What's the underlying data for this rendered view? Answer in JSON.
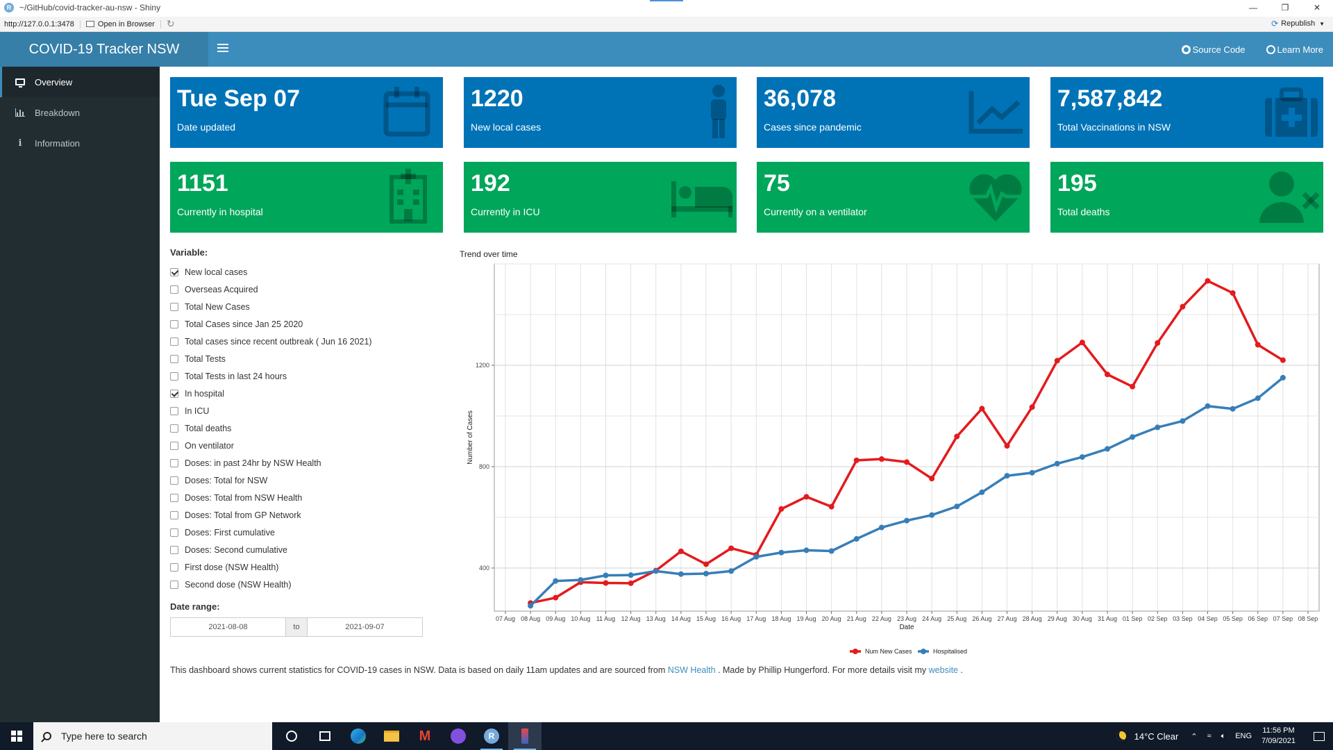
{
  "window": {
    "title": "~/GitHub/covid-tracker-au-nsw - Shiny",
    "url": "http://127.0.0.1:3478",
    "open_in_browser": "Open in Browser",
    "republish": "Republish"
  },
  "header": {
    "app_title": "COVID-19 Tracker NSW",
    "source_code": "Source Code",
    "learn_more": "Learn More"
  },
  "sidebar": {
    "items": [
      {
        "label": "Overview",
        "icon": "monitor-icon",
        "active": true
      },
      {
        "label": "Breakdown",
        "icon": "bar-chart-icon",
        "active": false
      },
      {
        "label": "Information",
        "icon": "info-icon",
        "active": false
      }
    ]
  },
  "value_boxes": [
    {
      "value": "Tue Sep 07",
      "subtitle": "Date updated",
      "color": "#0073b7",
      "icon": "calendar-icon"
    },
    {
      "value": "1220",
      "subtitle": "New local cases",
      "color": "#0073b7",
      "icon": "person-icon"
    },
    {
      "value": "36,078",
      "subtitle": "Cases since pandemic",
      "color": "#0073b7",
      "icon": "line-chart-icon"
    },
    {
      "value": "7,587,842",
      "subtitle": "Total Vaccinations in NSW",
      "color": "#0073b7",
      "icon": "medkit-icon"
    },
    {
      "value": "1151",
      "subtitle": "Currently in hospital",
      "color": "#00a65a",
      "icon": "hospital-icon"
    },
    {
      "value": "192",
      "subtitle": "Currently in ICU",
      "color": "#00a65a",
      "icon": "bed-icon"
    },
    {
      "value": "75",
      "subtitle": "Currently on a ventilator",
      "color": "#00a65a",
      "icon": "heartbeat-icon"
    },
    {
      "value": "195",
      "subtitle": "Total deaths",
      "color": "#00a65a",
      "icon": "user-times-icon"
    }
  ],
  "variable_panel": {
    "label": "Variable:",
    "options": [
      {
        "label": "New local cases",
        "checked": true
      },
      {
        "label": "Overseas Acquired",
        "checked": false
      },
      {
        "label": "Total New Cases",
        "checked": false
      },
      {
        "label": "Total Cases since Jan 25 2020",
        "checked": false
      },
      {
        "label": "Total cases since recent outbreak ( Jun 16 2021)",
        "checked": false
      },
      {
        "label": "Total Tests",
        "checked": false
      },
      {
        "label": "Total Tests in last 24 hours",
        "checked": false
      },
      {
        "label": "In hospital",
        "checked": true
      },
      {
        "label": "In ICU",
        "checked": false
      },
      {
        "label": "Total deaths",
        "checked": false
      },
      {
        "label": "On ventilator",
        "checked": false
      },
      {
        "label": "Doses: in past 24hr by NSW Health",
        "checked": false
      },
      {
        "label": "Doses: Total for NSW",
        "checked": false
      },
      {
        "label": "Doses: Total from NSW Health",
        "checked": false
      },
      {
        "label": "Doses: Total from GP Network",
        "checked": false
      },
      {
        "label": "Doses: First cumulative",
        "checked": false
      },
      {
        "label": "Doses: Second cumulative",
        "checked": false
      },
      {
        "label": "First dose (NSW Health)",
        "checked": false
      },
      {
        "label": "Second dose (NSW Health)",
        "checked": false
      }
    ]
  },
  "date_range": {
    "label": "Date range:",
    "start": "2021-08-08",
    "separator": "to",
    "end": "2021-09-07"
  },
  "footnote": {
    "text_before": "This dashboard shows current statistics for COVID-19 cases in NSW. Data is based on daily 11am updates and are sourced from ",
    "link1": "NSW Health",
    "text_middle": " . Made by Phillip Hungerford. For more details visit my ",
    "link2": "website",
    "text_after": " ."
  },
  "chart_data": {
    "type": "line",
    "title": "Trend over time",
    "xlabel": "Date",
    "ylabel": "Number of Cases",
    "categories": [
      "07 Aug",
      "08 Aug",
      "09 Aug",
      "10 Aug",
      "11 Aug",
      "12 Aug",
      "13 Aug",
      "14 Aug",
      "15 Aug",
      "16 Aug",
      "17 Aug",
      "18 Aug",
      "19 Aug",
      "20 Aug",
      "21 Aug",
      "22 Aug",
      "23 Aug",
      "24 Aug",
      "25 Aug",
      "26 Aug",
      "27 Aug",
      "28 Aug",
      "29 Aug",
      "30 Aug",
      "31 Aug",
      "01 Sep",
      "02 Sep",
      "03 Sep",
      "04 Sep",
      "05 Sep",
      "06 Sep",
      "07 Sep",
      "08 Sep"
    ],
    "series": [
      {
        "name": "Num New Cases",
        "color": "#e41a1c",
        "x": [
          "08 Aug",
          "09 Aug",
          "10 Aug",
          "11 Aug",
          "12 Aug",
          "13 Aug",
          "14 Aug",
          "15 Aug",
          "16 Aug",
          "17 Aug",
          "18 Aug",
          "19 Aug",
          "20 Aug",
          "21 Aug",
          "22 Aug",
          "23 Aug",
          "24 Aug",
          "25 Aug",
          "26 Aug",
          "27 Aug",
          "28 Aug",
          "29 Aug",
          "30 Aug",
          "31 Aug",
          "01 Sep",
          "02 Sep",
          "03 Sep",
          "04 Sep",
          "05 Sep",
          "06 Sep",
          "07 Sep"
        ],
        "values": [
          262,
          283,
          344,
          341,
          340,
          390,
          466,
          415,
          478,
          452,
          633,
          681,
          642,
          825,
          830,
          818,
          753,
          919,
          1029,
          882,
          1035,
          1218,
          1290,
          1164,
          1116,
          1288,
          1431,
          1533,
          1485,
          1281,
          1220
        ]
      },
      {
        "name": "Hospitalised",
        "color": "#377eb8",
        "x": [
          "08 Aug",
          "09 Aug",
          "10 Aug",
          "11 Aug",
          "12 Aug",
          "13 Aug",
          "14 Aug",
          "15 Aug",
          "16 Aug",
          "17 Aug",
          "18 Aug",
          "19 Aug",
          "20 Aug",
          "21 Aug",
          "22 Aug",
          "23 Aug",
          "24 Aug",
          "25 Aug",
          "26 Aug",
          "27 Aug",
          "28 Aug",
          "29 Aug",
          "30 Aug",
          "31 Aug",
          "01 Sep",
          "02 Sep",
          "03 Sep",
          "04 Sep",
          "05 Sep",
          "06 Sep",
          "07 Sep"
        ],
        "values": [
          251,
          349,
          353,
          371,
          372,
          388,
          376,
          378,
          388,
          444,
          461,
          470,
          467,
          515,
          560,
          587,
          609,
          643,
          699,
          764,
          776,
          812,
          838,
          870,
          917,
          955,
          980,
          1039,
          1028,
          1070,
          1151
        ]
      }
    ],
    "ylim": [
      230,
      1600
    ],
    "yticks": [
      400,
      800,
      1200
    ],
    "grid": true,
    "legend": "bottom"
  },
  "taskbar": {
    "search_placeholder": "Type here to search",
    "weather": "14°C  Clear",
    "lang": "ENG",
    "time": "11:56 PM",
    "date": "7/09/2021"
  }
}
